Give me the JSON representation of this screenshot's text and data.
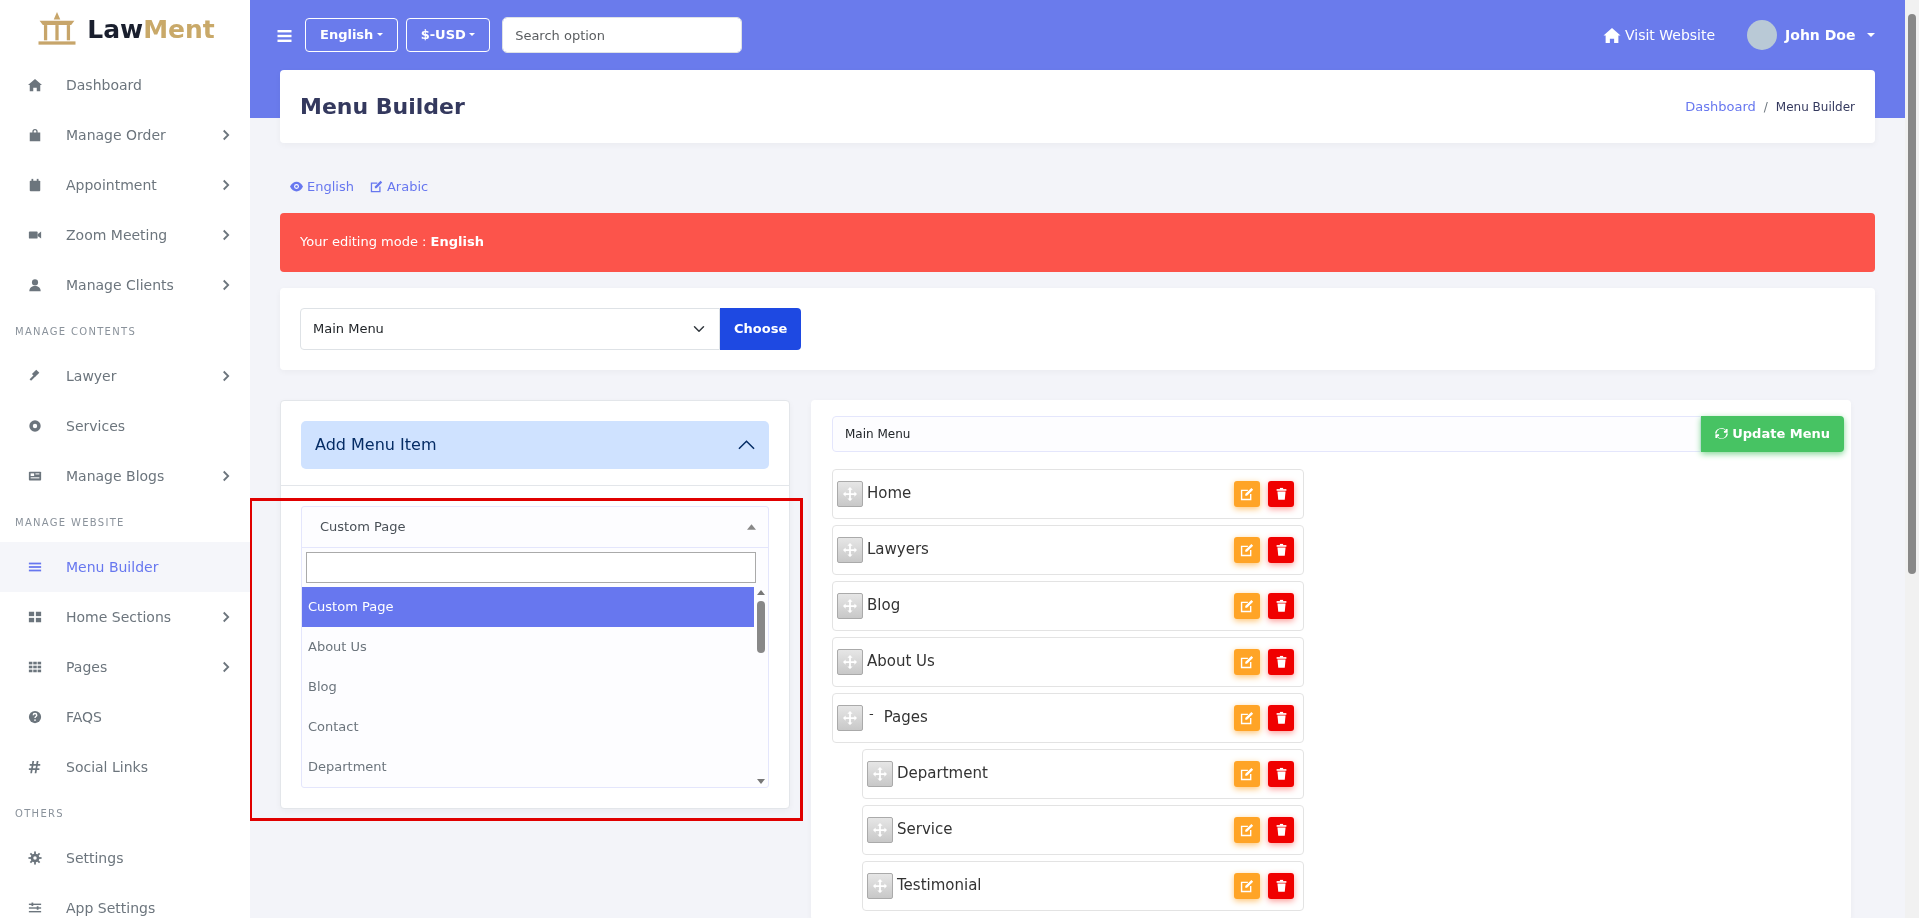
{
  "sidebar": {
    "logo": {
      "part_1": "Law",
      "part_2": "Ment"
    },
    "items": [
      {
        "kind": "link",
        "label": "Dashboard",
        "submenu": false,
        "selected": false
      },
      {
        "kind": "link",
        "label": "Manage Order",
        "submenu": true,
        "selected": false
      },
      {
        "kind": "link",
        "label": "Appointment",
        "submenu": true,
        "selected": false
      },
      {
        "kind": "link",
        "label": "Zoom Meeting",
        "submenu": true,
        "selected": false
      },
      {
        "kind": "link",
        "label": "Manage Clients",
        "submenu": true,
        "selected": false
      },
      {
        "kind": "heading",
        "label": "MANAGE CONTENTS"
      },
      {
        "kind": "link",
        "label": "Lawyer",
        "submenu": true,
        "selected": false
      },
      {
        "kind": "link",
        "label": "Services",
        "submenu": false,
        "selected": false
      },
      {
        "kind": "link",
        "label": "Manage Blogs",
        "submenu": true,
        "selected": false
      },
      {
        "kind": "heading",
        "label": "MANAGE WEBSITE"
      },
      {
        "kind": "link",
        "label": "Menu Builder",
        "submenu": false,
        "selected": true
      },
      {
        "kind": "link",
        "label": "Home Sections",
        "submenu": true,
        "selected": false
      },
      {
        "kind": "link",
        "label": "Pages",
        "submenu": true,
        "selected": false
      },
      {
        "kind": "link",
        "label": "FAQS",
        "submenu": false,
        "selected": false
      },
      {
        "kind": "link",
        "label": "Social Links",
        "submenu": false,
        "selected": false
      },
      {
        "kind": "heading",
        "label": "OTHERS"
      },
      {
        "kind": "link",
        "label": "Settings",
        "submenu": false,
        "selected": false
      },
      {
        "kind": "link",
        "label": "App Settings",
        "submenu": false,
        "selected": false
      }
    ]
  },
  "topbar": {
    "language": "English",
    "currency": "$-USD",
    "search": {
      "placeholder": "Search option"
    },
    "visit": "Visit Website",
    "user": "John Doe"
  },
  "page_header": {
    "title": "Menu Builder",
    "breadcrumb": [
      "Dashboard",
      "Menu Builder"
    ],
    "separator": "/"
  },
  "language_links": [
    {
      "label": "English"
    },
    {
      "label": "Arabic"
    }
  ],
  "alert": "Your editing mode : **English**",
  "menu_select": {
    "value": "Main Menu",
    "button": "Choose"
  },
  "add_panel": {
    "title": "Add Menu Item",
    "expanded": true,
    "dropdown": {
      "value": "Custom Page",
      "open": true,
      "options": [
        {
          "label": "Custom Page",
          "selected": true
        },
        {
          "label": "About Us",
          "selected": false
        },
        {
          "label": "Blog",
          "selected": false
        },
        {
          "label": "Contact",
          "selected": false
        },
        {
          "label": "Department",
          "selected": false
        }
      ]
    }
  },
  "menu_editor": {
    "name": "Main Menu",
    "button": "Update Menu",
    "items": [
      {
        "label": "Home"
      },
      {
        "label": "Lawyers"
      },
      {
        "label": "Blog"
      },
      {
        "label": "About Us"
      },
      {
        "label": "Pages",
        "collapse_mark": "-",
        "children": [
          {
            "label": "Department"
          },
          {
            "label": "Service"
          },
          {
            "label": "Testimonial"
          }
        ]
      }
    ]
  }
}
